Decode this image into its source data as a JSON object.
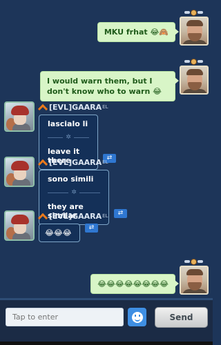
{
  "messages": [
    {
      "side": "own",
      "text": "MKU frhat 😂🙈"
    },
    {
      "side": "own",
      "text": "I would warn them, but I don't know who to warn 😂"
    },
    {
      "side": "other",
      "sender": "[EVL]GAARA",
      "sender_sup": "EL",
      "original": "lascialo li",
      "translation": "leave it there"
    },
    {
      "side": "other",
      "sender": "[EVL]GAARA",
      "sender_sup": "EL",
      "original": "sono simili",
      "translation": "they are similar"
    },
    {
      "side": "other",
      "sender": "[EVL]GAARA",
      "sender_sup": "EL",
      "original": "😂😂😂"
    },
    {
      "side": "own",
      "text": "😂😂😂😂😂😂😂😂"
    }
  ],
  "input": {
    "placeholder": "Tap to enter",
    "value": ""
  },
  "send_label": "Send",
  "icons": {
    "translate": "translate-icon",
    "emoji": "emoji-icon",
    "rank": "rank-badge-icon",
    "clan": "chevron-icon"
  },
  "colors": {
    "own_bubble": "#d8f5c7",
    "own_text": "#1f5b1a",
    "background": "#1d3559",
    "accent": "#2f77d1"
  }
}
